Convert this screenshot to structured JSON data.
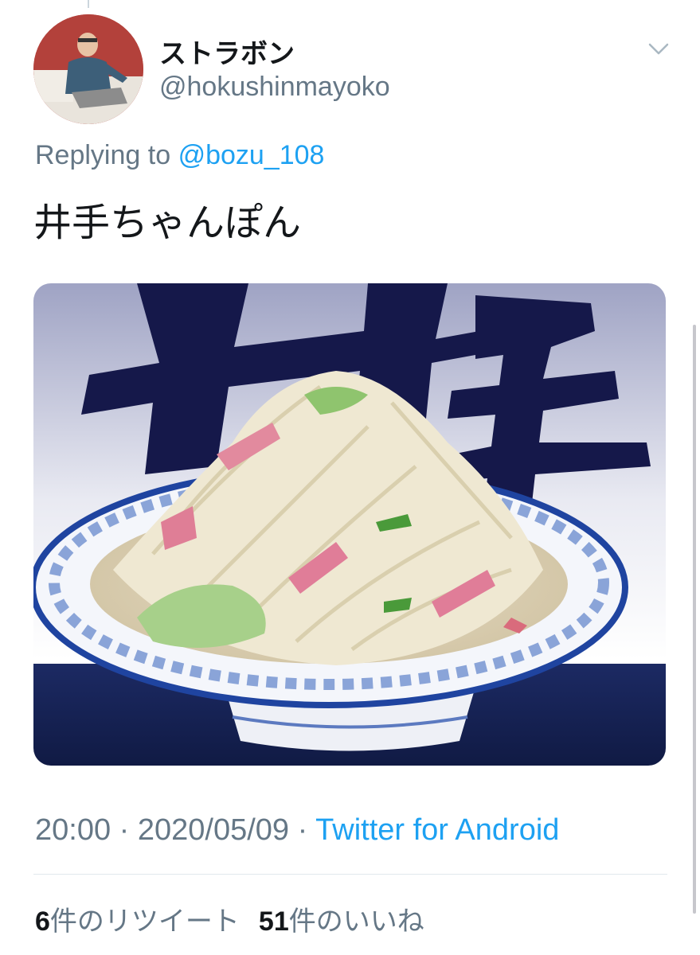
{
  "tweet": {
    "display_name": "ストラボン",
    "handle": "@hokushinmayoko",
    "reply_prefix": "Replying to",
    "reply_to": "@bozu_108",
    "text": "井手ちゃんぽん",
    "time": "20:00",
    "separator": "·",
    "date": "2020/05/09",
    "source": "Twitter for Android"
  },
  "stats": {
    "retweet_count": "6",
    "retweet_label": "件のリツイート",
    "like_count": "51",
    "like_label": "件のいいね"
  },
  "icons": {
    "menu": "chevron-down-icon"
  },
  "colors": {
    "link": "#1da1f2",
    "secondary_text": "#657786",
    "primary_text": "#14171a"
  }
}
